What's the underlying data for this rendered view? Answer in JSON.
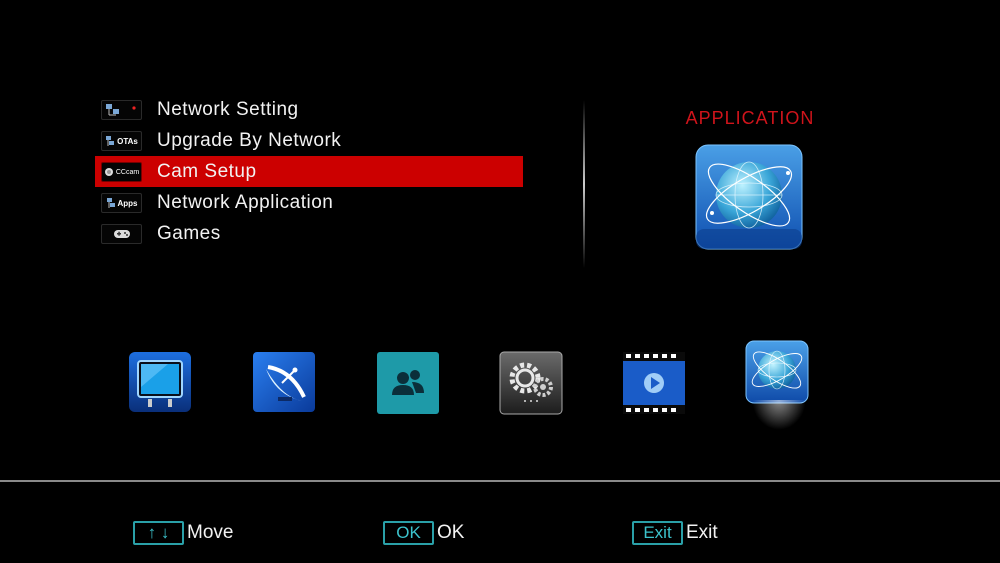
{
  "menu": {
    "items": [
      {
        "label": "Network Setting",
        "icon": "network-icon",
        "icon_text": ""
      },
      {
        "label": "Upgrade By Network",
        "icon": "ota-icon",
        "icon_text": "OTAs"
      },
      {
        "label": "Cam Setup",
        "icon": "cccam-icon",
        "icon_text": "CCcam",
        "selected": true
      },
      {
        "label": "Network Application",
        "icon": "apps-icon",
        "icon_text": "Apps"
      },
      {
        "label": "Games",
        "icon": "gamepad-icon",
        "icon_text": ""
      }
    ]
  },
  "panel": {
    "title": "APPLICATION",
    "icon": "globe-icon"
  },
  "categories": [
    {
      "name": "tv-icon"
    },
    {
      "name": "satellite-dish-icon"
    },
    {
      "name": "users-icon"
    },
    {
      "name": "settings-gears-icon"
    },
    {
      "name": "media-play-icon"
    },
    {
      "name": "globe-icon",
      "selected": true
    }
  ],
  "footer": {
    "move_key": "↑ ↓",
    "move_label": "Move",
    "ok_key": "OK",
    "ok_label": "OK",
    "exit_key": "Exit",
    "exit_label": "Exit"
  },
  "colors": {
    "highlight": "#cc0000",
    "title": "#d0141b",
    "key_border": "#2aa0a8"
  }
}
